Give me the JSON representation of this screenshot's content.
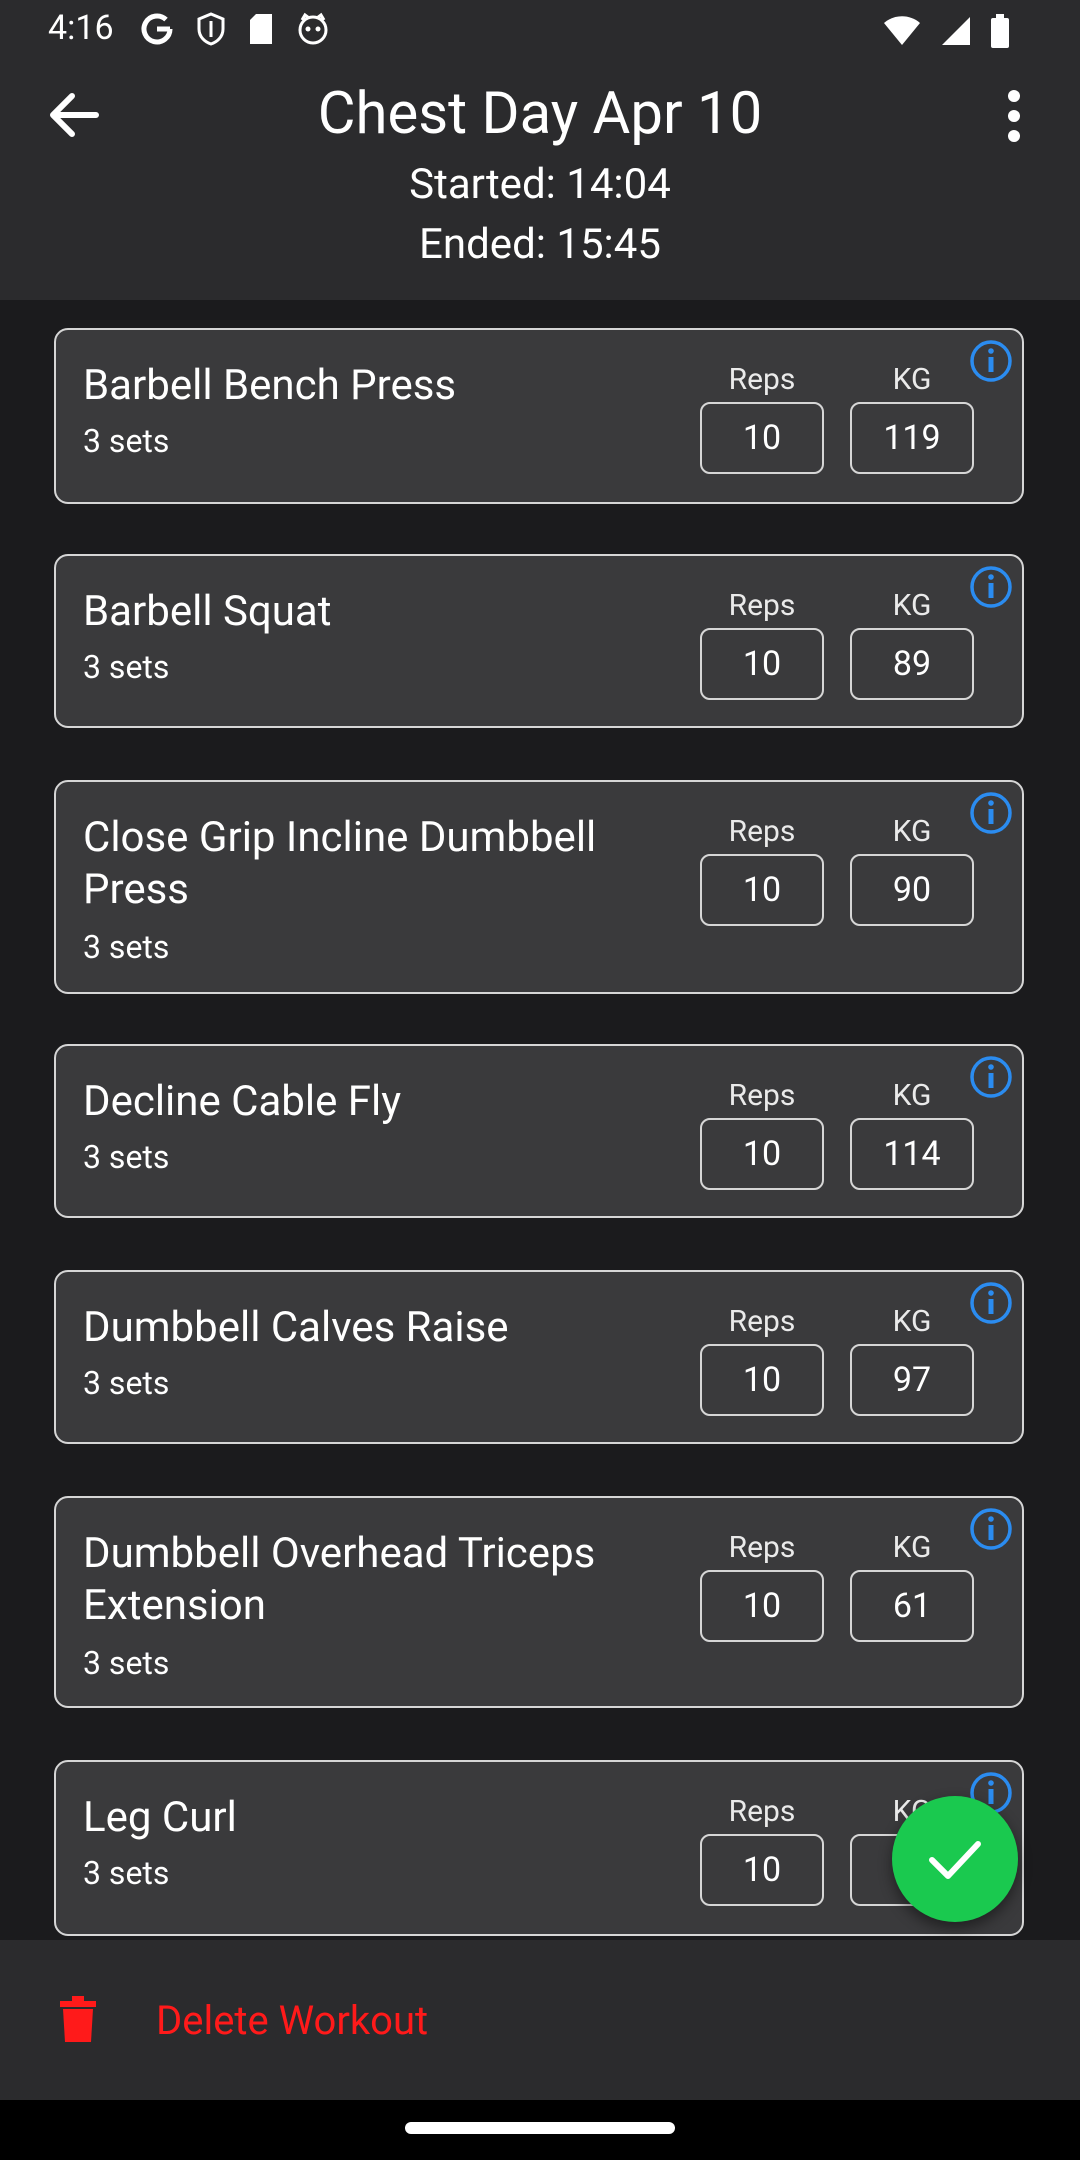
{
  "status": {
    "time": "4:16",
    "left_icons": [
      "google-icon",
      "shield-icon",
      "sd-card-icon",
      "cat-icon"
    ],
    "right_icons": [
      "wifi-icon",
      "signal-icon",
      "battery-icon"
    ]
  },
  "header": {
    "title": "Chest Day Apr 10",
    "started": "Started: 14:04",
    "ended": "Ended: 15:45"
  },
  "columns": {
    "reps": "Reps",
    "kg": "KG"
  },
  "exercises": [
    {
      "name": "Barbell Bench Press",
      "sets": "3 sets",
      "reps": "10",
      "kg": "119"
    },
    {
      "name": "Barbell Squat",
      "sets": "3 sets",
      "reps": "10",
      "kg": "89"
    },
    {
      "name": "Close Grip Incline Dumbbell Press",
      "sets": "3 sets",
      "reps": "10",
      "kg": "90"
    },
    {
      "name": "Decline Cable Fly",
      "sets": "3 sets",
      "reps": "10",
      "kg": "114"
    },
    {
      "name": "Dumbbell Calves Raise",
      "sets": "3 sets",
      "reps": "10",
      "kg": "97"
    },
    {
      "name": "Dumbbell Overhead Triceps Extension",
      "sets": "3 sets",
      "reps": "10",
      "kg": "61"
    },
    {
      "name": "Leg Curl",
      "sets": "3 sets",
      "reps": "10",
      "kg": ""
    }
  ],
  "actions": {
    "delete_label": "Delete Workout"
  },
  "colors": {
    "accent_info": "#2b8cf0",
    "fab": "#1ac94f",
    "danger": "#ff1a1a"
  }
}
